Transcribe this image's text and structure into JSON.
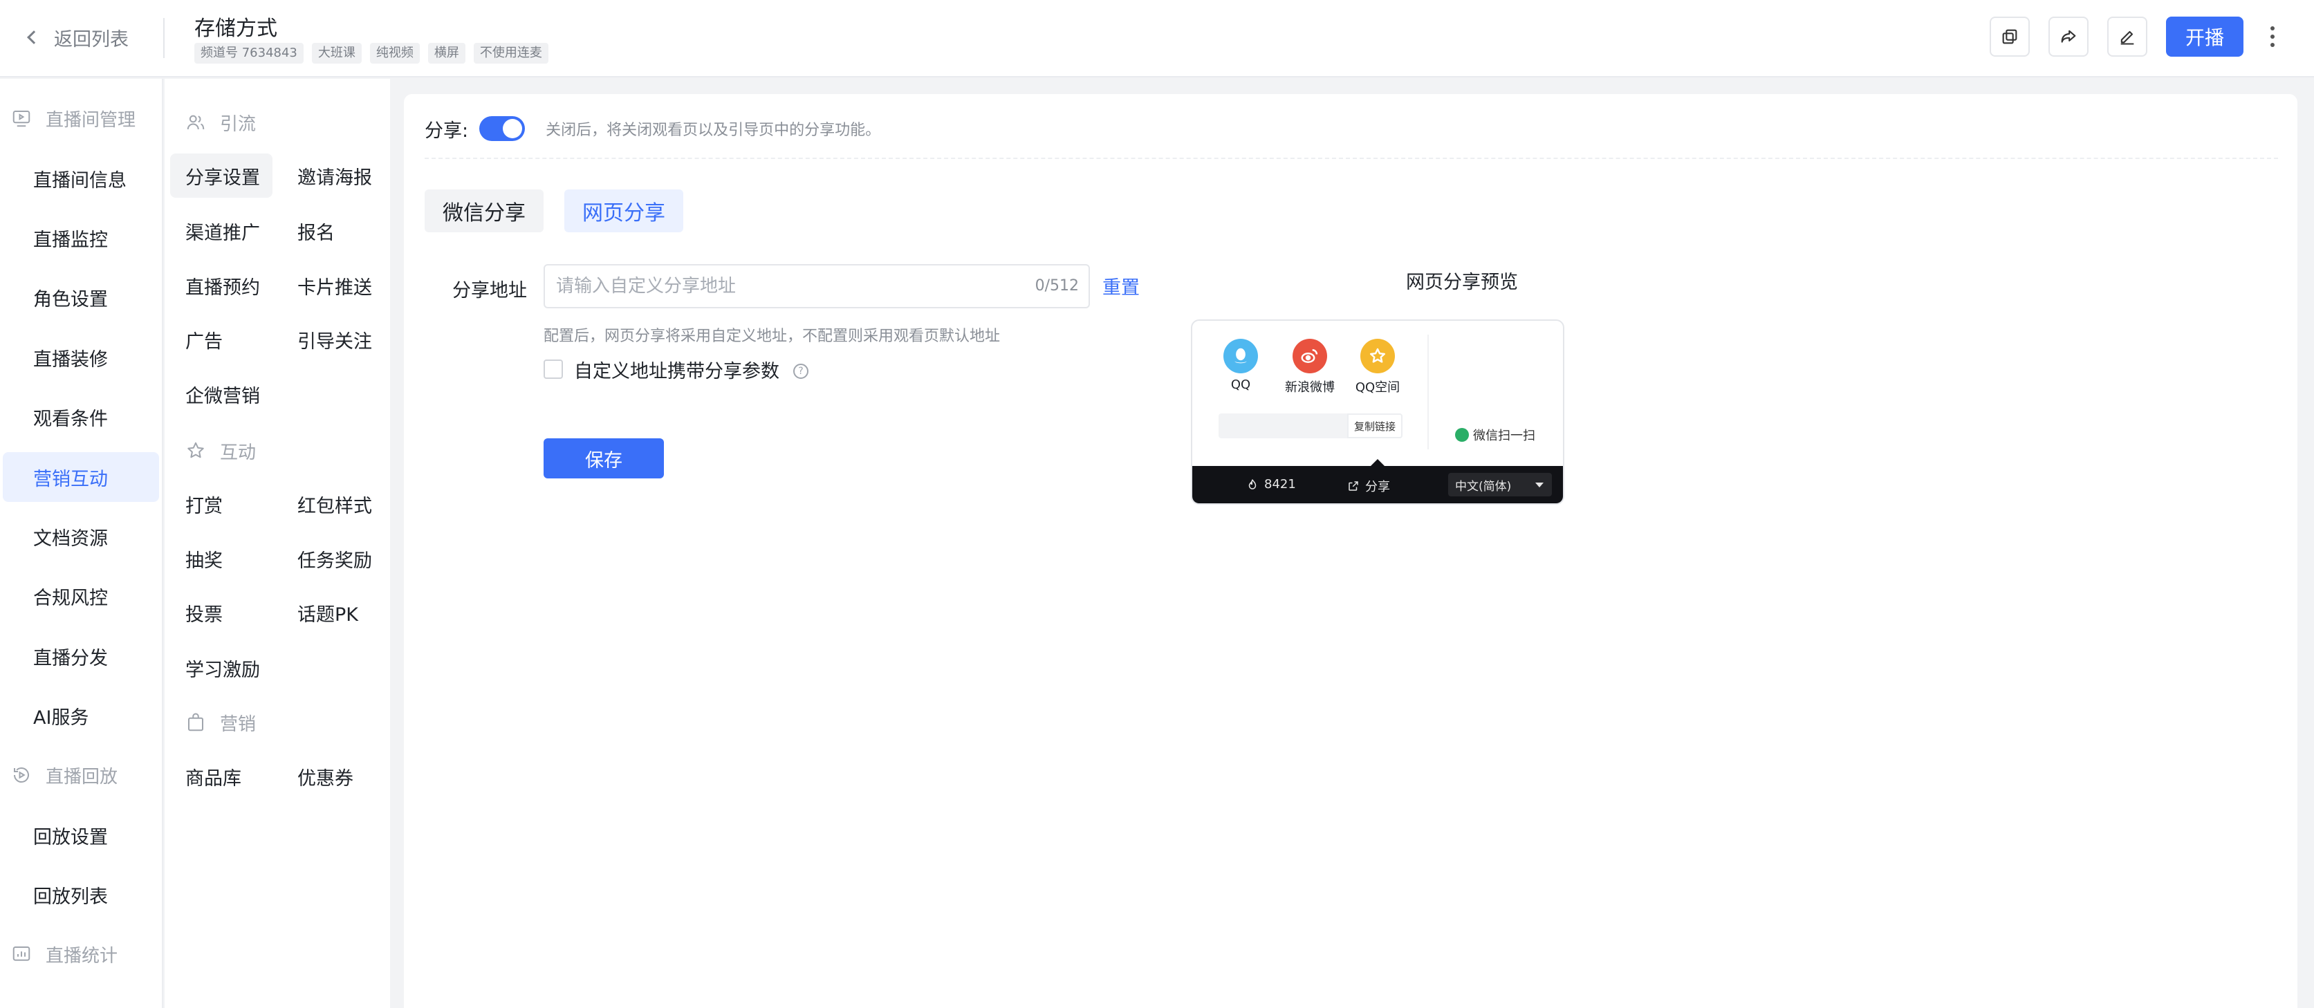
{
  "header": {
    "back_label": "返回列表",
    "title": "存储方式",
    "tags": [
      "频道号 7634843",
      "大班课",
      "纯视频",
      "横屏",
      "不使用连麦"
    ],
    "start_label": "开播",
    "icons": [
      "copy-icon",
      "share-icon",
      "edit-icon",
      "more-icon"
    ]
  },
  "sidebar": {
    "groups": [
      {
        "label": "直播间管理",
        "icon": "live-room-icon"
      },
      {
        "label": "直播回放",
        "icon": "replay-icon"
      },
      {
        "label": "直播统计",
        "icon": "stats-icon"
      }
    ],
    "items": [
      "直播间信息",
      "直播监控",
      "角色设置",
      "直播装修",
      "观看条件",
      "营销互动",
      "文档资源",
      "合规风控",
      "直播分发",
      "AI服务",
      "回放设置",
      "回放列表"
    ],
    "active_item": "营销互动"
  },
  "subnav": {
    "groups": [
      {
        "label": "引流",
        "icon": "users-icon"
      },
      {
        "label": "互动",
        "icon": "star-icon"
      },
      {
        "label": "营销",
        "icon": "bag-icon"
      }
    ],
    "yinliu": [
      "分享设置",
      "邀请海报",
      "渠道推广",
      "报名",
      "直播预约",
      "卡片推送",
      "广告",
      "引导关注",
      "企微营销"
    ],
    "hudong": [
      "打赏",
      "红包样式",
      "抽奖",
      "任务奖励",
      "投票",
      "话题PK",
      "学习激励"
    ],
    "yingxiao": [
      "商品库",
      "优惠券"
    ],
    "active": "分享设置"
  },
  "main": {
    "share_label": "分享:",
    "share_enabled": true,
    "share_hint": "关闭后，将关闭观看页以及引导页中的分享功能。",
    "tabs": [
      "微信分享",
      "网页分享"
    ],
    "active_tab": "网页分享",
    "url_label": "分享地址",
    "url_placeholder": "请输入自定义分享地址",
    "url_value": "",
    "url_counter": "0/512",
    "reset_label": "重置",
    "help_text": "配置后，网页分享将采用自定义地址，不配置则采用观看页默认地址",
    "checkbox_label": "自定义地址携带分享参数",
    "checkbox_checked": false,
    "save_label": "保存"
  },
  "preview": {
    "title": "网页分享预览",
    "socials": [
      {
        "label": "QQ",
        "color": "#4fb8f0",
        "icon": "qq-icon"
      },
      {
        "label": "新浪微博",
        "color": "#e9523f",
        "icon": "weibo-icon"
      },
      {
        "label": "QQ空间",
        "color": "#f5b82e",
        "icon": "qzone-icon"
      }
    ],
    "copy_label": "复制链接",
    "wechat_label": "微信扫一扫",
    "view_count": "8421",
    "share_label": "分享",
    "lang_label": "中文(简体)"
  },
  "colors": {
    "accent": "#3a6ff8",
    "accent_bg": "#ebf1ff"
  }
}
